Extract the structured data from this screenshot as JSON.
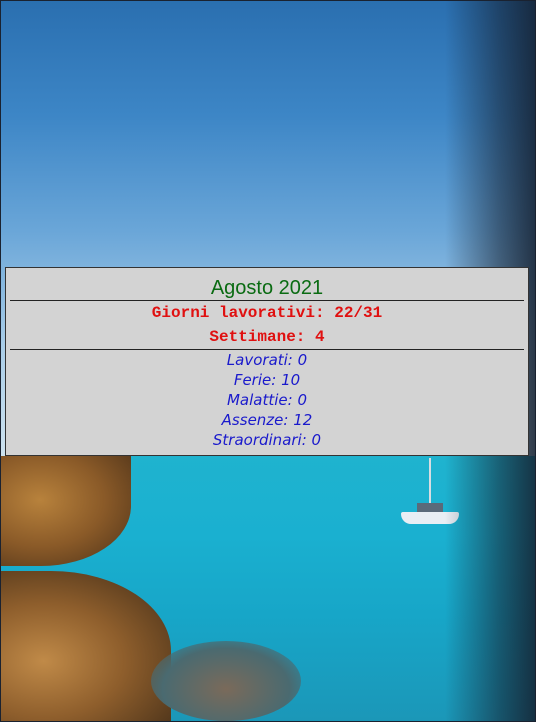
{
  "panel": {
    "title": "Agosto 2021",
    "working_days": "Giorni lavorativi: 22/31",
    "weeks": "Settimane: 4",
    "counts": {
      "worked": "Lavorati: 0",
      "holidays": "Ferie: 10",
      "sick": "Malattie: 0",
      "absences": "Assenze: 12",
      "overtime": "Straordinari: 0"
    }
  },
  "colors": {
    "title": "#0a6b12",
    "highlight": "#e01010",
    "counts": "#1a1acc",
    "panel_bg": "#d3d3d3"
  }
}
